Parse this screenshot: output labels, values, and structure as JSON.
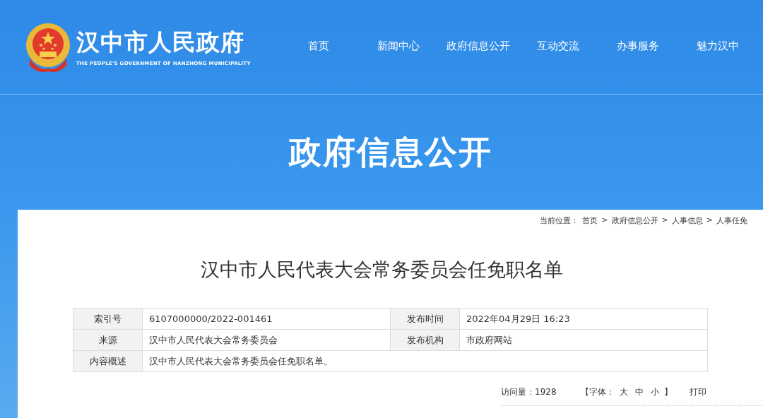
{
  "header": {
    "site_name": "汉中市人民政府",
    "site_subtitle": "THE PEOPLE'S GOVERNMENT OF HANZHONG MUNICIPALITY",
    "nav": [
      {
        "label": "首页",
        "selected": false
      },
      {
        "label": "新闻中心",
        "selected": false
      },
      {
        "label": "政府信息公开",
        "selected": false
      },
      {
        "label": "互动交流",
        "selected": false
      },
      {
        "label": "办事服务",
        "selected": false
      },
      {
        "label": "魅力汉中",
        "selected": false
      }
    ]
  },
  "banner": {
    "title": "政府信息公开"
  },
  "breadcrumb": {
    "label": "当前位置：",
    "items": [
      "首页",
      "政府信息公开",
      "人事信息",
      "人事任免"
    ],
    "separator": ">"
  },
  "article": {
    "title": "汉中市人民代表大会常务委员会任免职名单"
  },
  "info_table": {
    "rows": [
      [
        {
          "label": "索引号",
          "value": "6107000000/2022-001461"
        },
        {
          "label": "发布时间",
          "value": "2022年04月29日 16:23"
        }
      ],
      [
        {
          "label": "来源",
          "value": "汉中市人民代表大会常务委员会"
        },
        {
          "label": "发布机构",
          "value": "市政府网站"
        }
      ],
      [
        {
          "label": "内容概述",
          "value": "汉中市人民代表大会常务委员会任免职名单。"
        }
      ]
    ]
  },
  "footer": {
    "views": "访问量：1928",
    "font_label": "【字体：",
    "font_sizes": [
      "大",
      "中",
      "小"
    ],
    "font_close": "】",
    "print": "打印"
  }
}
